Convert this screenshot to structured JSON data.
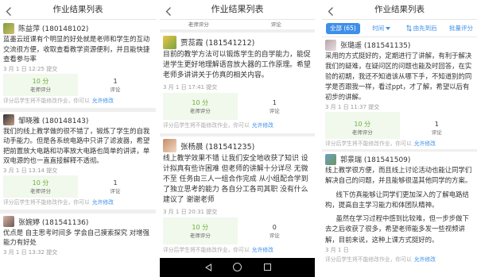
{
  "app": {
    "title": "作业结果列表"
  },
  "labels": {
    "teacher_score": "老师评分",
    "comments": "评论",
    "note": "评分后学生将不能修改作业，你可以",
    "allow_edit": "允许修改"
  },
  "icons": {
    "back": "chevron-left-icon",
    "sort_field": "caret-down-icon",
    "sort_order": "sort-icon",
    "nav": [
      "nav-back-icon",
      "nav-home-icon",
      "nav-recents-icon"
    ]
  },
  "colors": {
    "accent": "#3d8fe8",
    "score_green": "#6ab23c",
    "nav_bar": "#000000"
  },
  "panel1": {
    "entries": [
      {
        "name": "陈益萍 (180148102)",
        "text": "蓝墨云班课有个明显的好处就是老师和学生的互动交流很方便，收取查看教学资源便利，并且能快捷查看参与率",
        "date": "3 月 1 日 12:25 提交",
        "score": "10 分",
        "comments": "1"
      },
      {
        "name": "邹晓雅 (180148143)",
        "text": "我们的线上教学做的很不错了，锻炼了学生的自我动手能力。但是各系统电路中只讲了滤波器，希望把前置放大电路和功率放大电路也简单的讲讲，单双电源的也一直直接解释不透彻。",
        "date": "3 月 1 日 13:14 提交",
        "score": "10 分",
        "comments": "1"
      },
      {
        "name": "张婉婷 (181541136)",
        "text": "优点是 自主思考时间多 学会自己摸索探究 对增强能力有好处",
        "date": "3 月 1 日 13:32 提交"
      }
    ]
  },
  "panel2": {
    "entries": [
      {
        "name": "贾蕊霞 (181541212)",
        "text": "目前的教学方法可以锻炼学生的自学能力，能促进学生更好地理解语音放大器的工作原理。希望老师多讲讲关于仿真的相关内容。",
        "date": "3 月 1 日 17:41 提交",
        "score": "10 分",
        "comments": "1"
      },
      {
        "name": "张杨晨 (181541235)",
        "text": "线上教学效果不错 让我们安全地收获了知识 设计拟真有些许困难 但老师的讲解十分详尽 无微不至 任务由三人一组合作完成 从小组配合学到了独立思考的能力 各自分工各司其职 没有什么建议了 谢谢老师",
        "date": "3 月 1 日 20:31 提交",
        "score": "10 分",
        "comments": "0"
      }
    ]
  },
  "panel3": {
    "filter": {
      "all": "全部 (65)",
      "time": "时间",
      "order": "由先到后",
      "batch": "批量评分"
    },
    "entries": [
      {
        "name": "张璐遥 (181541135)",
        "text": "采用的方式挺好的，定期进行了讲解，有利于解决我们的疑难，在疑问区的问题也能及时回答，在实验的初期，我还不知道该从哪下手，不知道别的同学是否跟我一样，看过ppt，才了解，希望以后有初步的讲解。",
        "date": "3 月 1 日 11:37 提交",
        "score": "10 分",
        "comments": "1"
      },
      {
        "name": "郭景瑞 (181541509)",
        "paragraphs": [
          "线上教学很方便，而且线上讨论活动也能让同学们解决自己的问题，并且能够很温其他同学的方案。",
          "线下仿真能够让同学们更加深入的了解电路结构，提高自主学习能力和体团队精神。",
          "虽然在学习过程中感到比较难，但一步步做下去之后收获了很多，希望老师能多发一些视频讲解，目前来说，这种上课方式挺好的。"
        ],
        "date": "3 月 1 日"
      }
    ]
  }
}
